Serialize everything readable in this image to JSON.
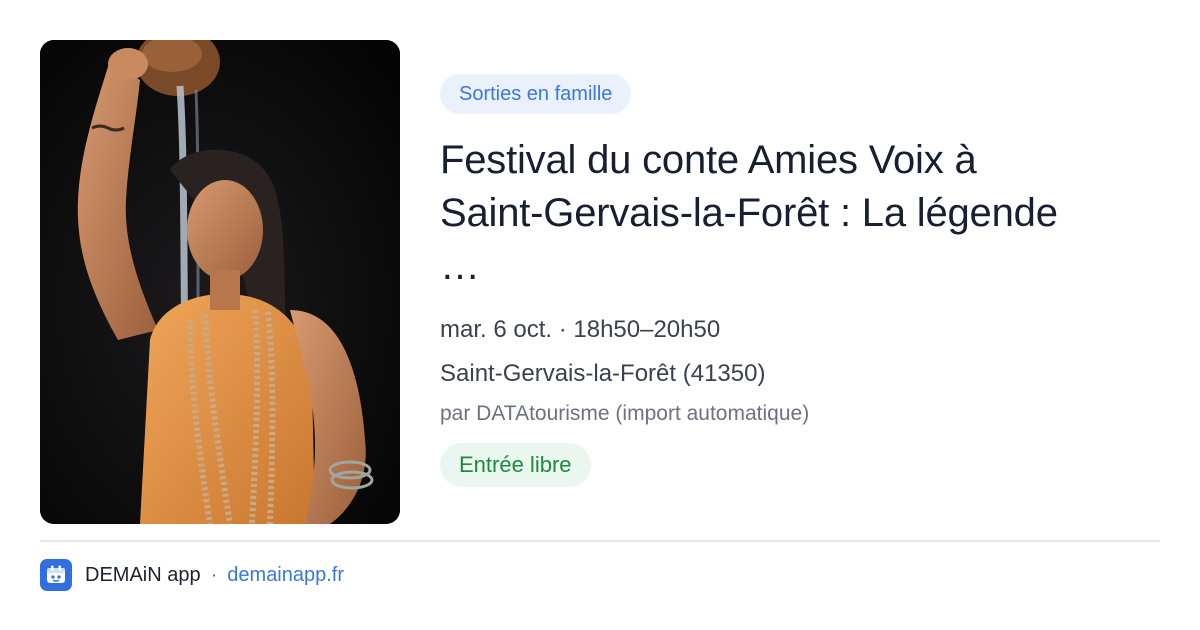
{
  "event": {
    "image_alt": "Conteuse versant du sable d'une calebasse sur scène",
    "category": "Sorties en famille",
    "title": "Festival du conte Amies Voix à Saint-Gervais-la-Forêt : La légende …",
    "date_time": "mar. 6 oct. · 18h50–20h50",
    "location": "Saint-Gervais-la-Forêt (41350)",
    "source": "par DATAtourisme (import automatique)",
    "price": "Entrée libre"
  },
  "footer": {
    "app_icon": "demain-app-icon",
    "app_name": "DEMAiN app",
    "separator": "·",
    "url": "demainapp.fr"
  },
  "colors": {
    "accent": "#3b78d8",
    "category_bg": "#eaf1fd",
    "price_text": "#1f8a3d",
    "price_bg": "#eaf7ee",
    "title": "#172033"
  }
}
